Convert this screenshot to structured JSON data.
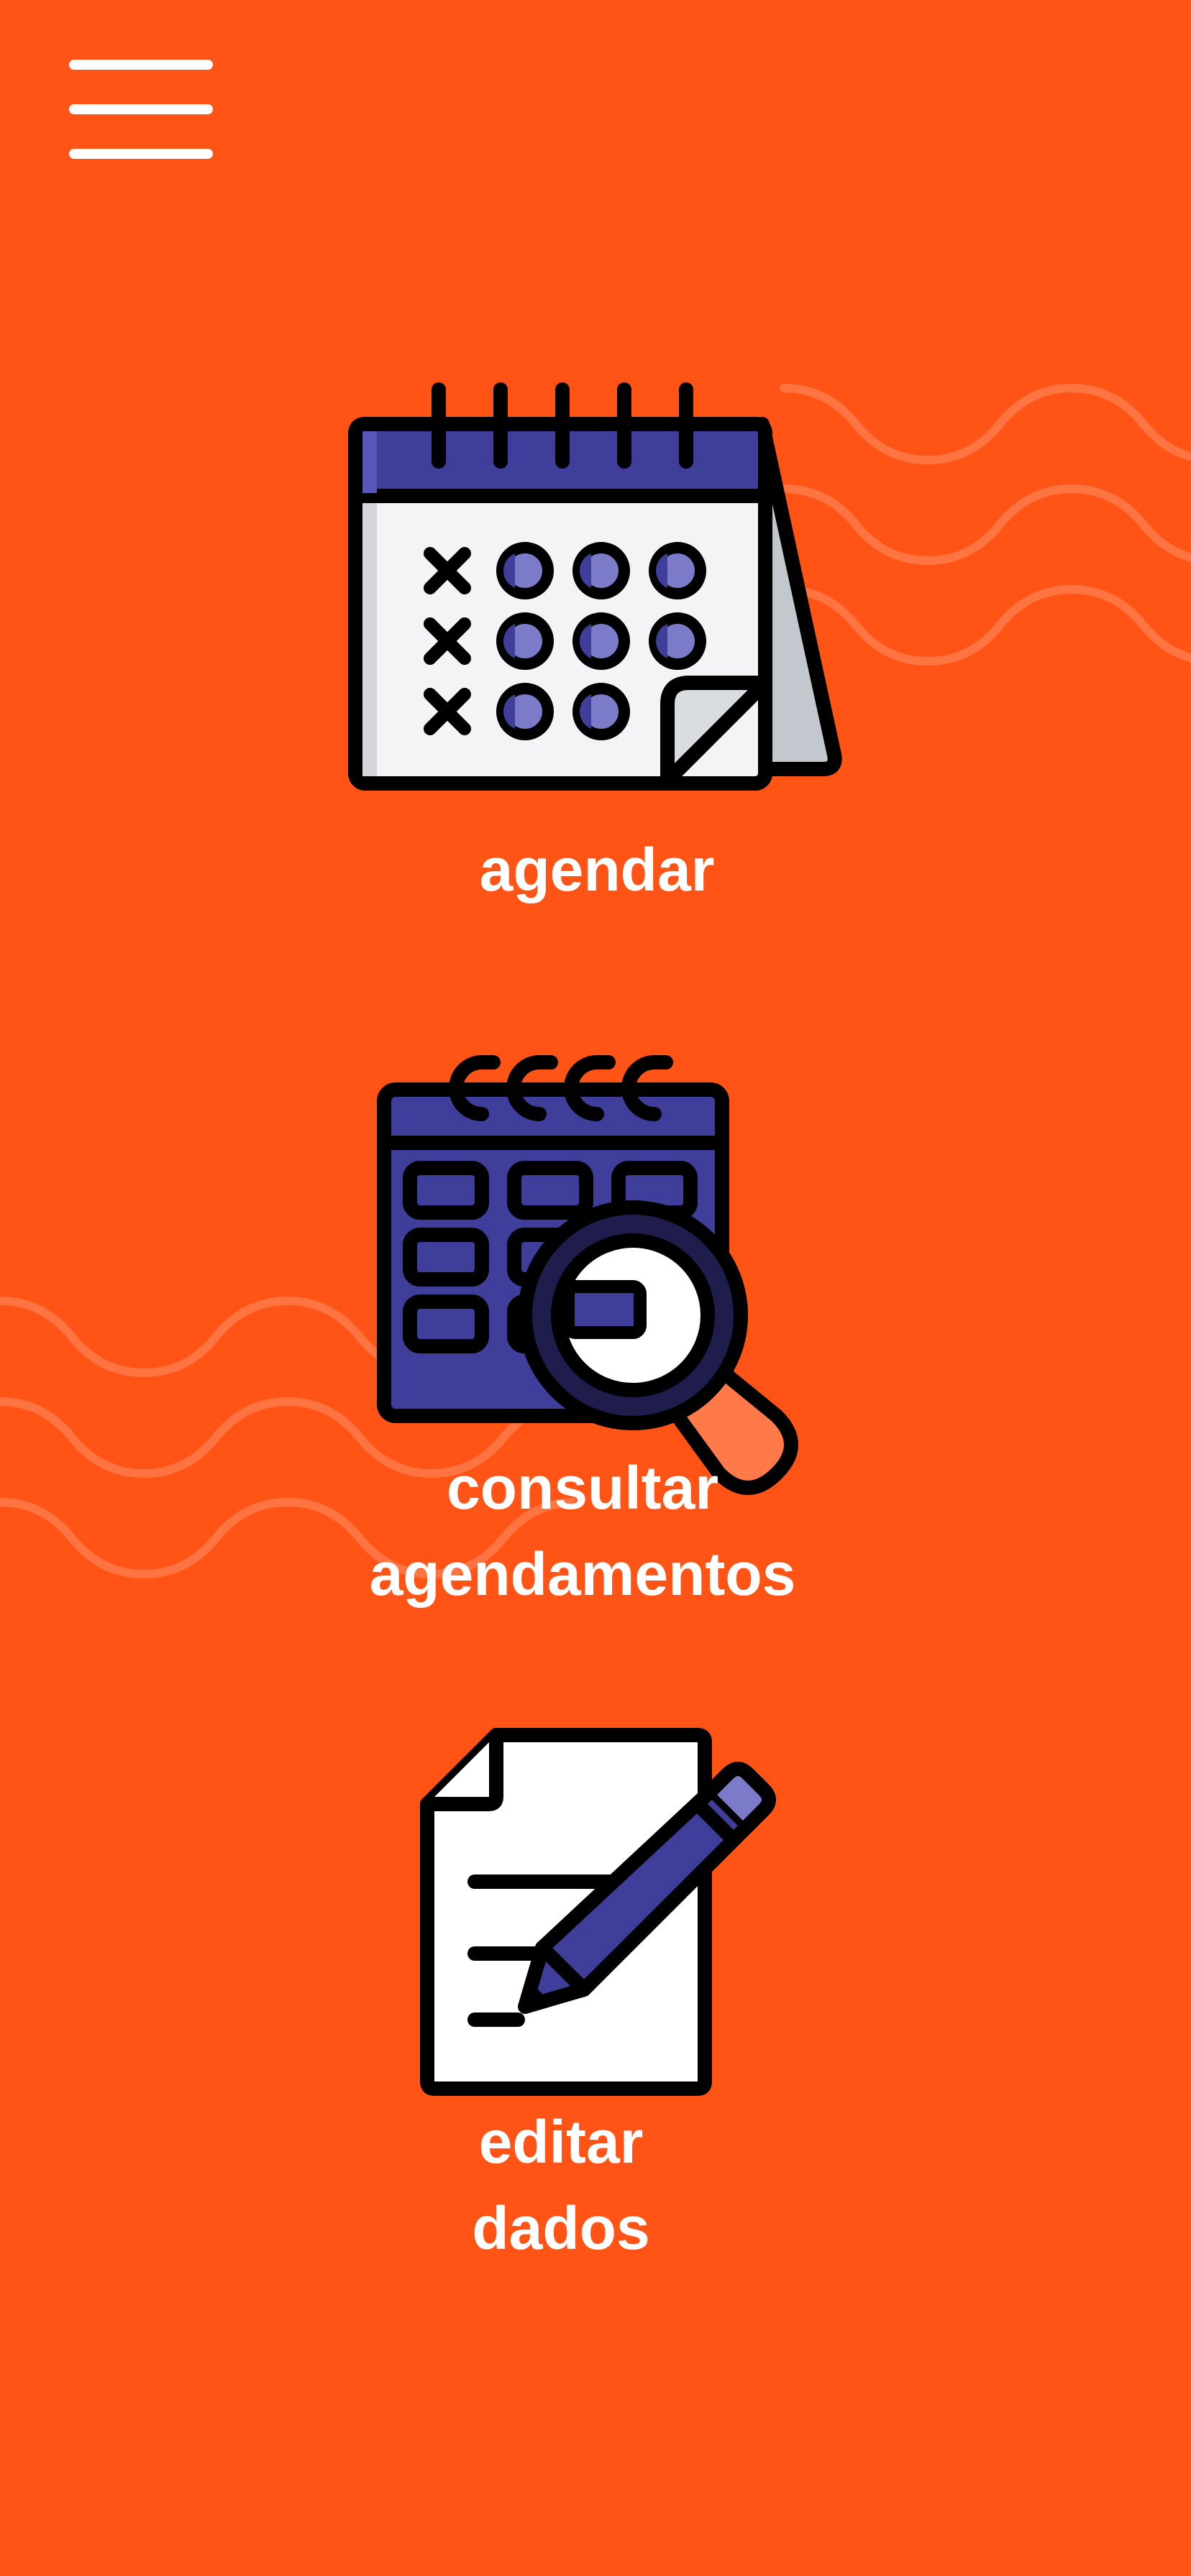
{
  "colors": {
    "background": "#FF5416",
    "label": "#FFFFFF",
    "icon_outline": "#000000",
    "icon_primary": "#3F3E9A",
    "icon_primary_light": "#7C7BCA",
    "icon_paper": "#F4F4F6",
    "icon_paper_shadow": "#C3C7CE",
    "magnifier_handle": "#FF7A48"
  },
  "header": {
    "menu_icon": "hamburger-menu-icon"
  },
  "options": [
    {
      "id": "agendar",
      "icon": "calendar-icon",
      "label_lines": [
        "agendar"
      ]
    },
    {
      "id": "consultar",
      "icon": "calendar-search-icon",
      "label_lines": [
        "consultar",
        "agendamentos"
      ]
    },
    {
      "id": "editar",
      "icon": "document-edit-icon",
      "label_lines": [
        "editar",
        "dados"
      ]
    }
  ]
}
